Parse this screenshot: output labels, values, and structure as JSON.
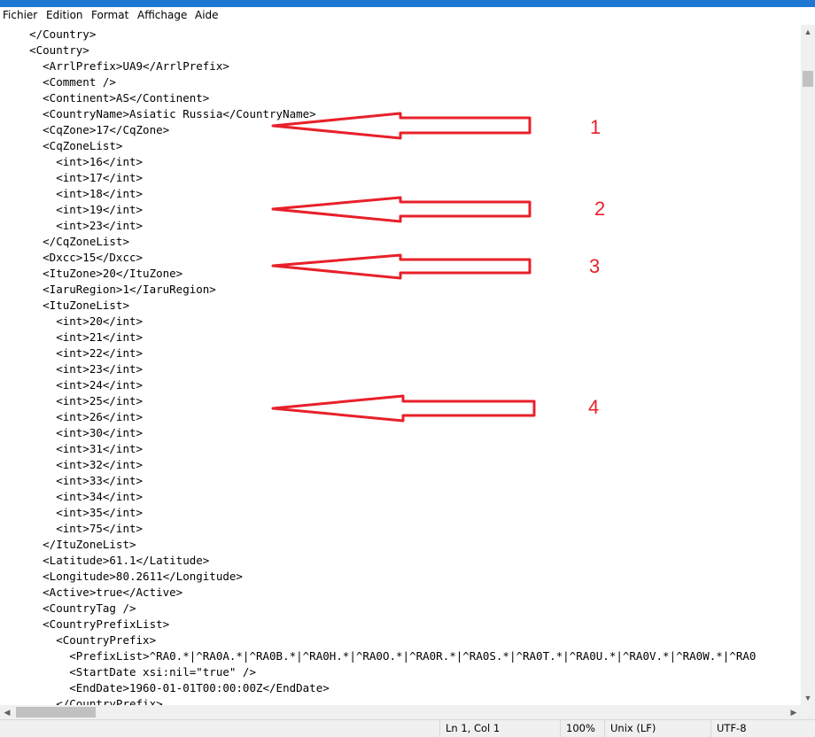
{
  "menu": [
    "Fichier",
    "Edition",
    "Format",
    "Affichage",
    "Aide"
  ],
  "lines": [
    "    </Country>",
    "    <Country>",
    "      <ArrlPrefix>UA9</ArrlPrefix>",
    "      <Comment />",
    "      <Continent>AS</Continent>",
    "      <CountryName>Asiatic Russia</CountryName>",
    "      <CqZone>17</CqZone>",
    "      <CqZoneList>",
    "        <int>16</int>",
    "        <int>17</int>",
    "        <int>18</int>",
    "        <int>19</int>",
    "        <int>23</int>",
    "      </CqZoneList>",
    "      <Dxcc>15</Dxcc>",
    "      <ItuZone>20</ItuZone>",
    "      <IaruRegion>1</IaruRegion>",
    "      <ItuZoneList>",
    "        <int>20</int>",
    "        <int>21</int>",
    "        <int>22</int>",
    "        <int>23</int>",
    "        <int>24</int>",
    "        <int>25</int>",
    "        <int>26</int>",
    "        <int>30</int>",
    "        <int>31</int>",
    "        <int>32</int>",
    "        <int>33</int>",
    "        <int>34</int>",
    "        <int>35</int>",
    "        <int>75</int>",
    "      </ItuZoneList>",
    "      <Latitude>61.1</Latitude>",
    "      <Longitude>80.2611</Longitude>",
    "      <Active>true</Active>",
    "      <CountryTag />",
    "      <CountryPrefixList>",
    "        <CountryPrefix>",
    "          <PrefixList>^RA0.*|^RA0A.*|^RA0B.*|^RA0H.*|^RA0O.*|^RA0R.*|^RA0S.*|^RA0T.*|^RA0U.*|^RA0V.*|^RA0W.*|^RA0",
    "          <StartDate xsi:nil=\"true\" />",
    "          <EndDate>1960-01-01T00:00:00Z</EndDate>",
    "        </CountryPrefix>"
  ],
  "annotations": [
    "1",
    "2",
    "3",
    "4"
  ],
  "annotation_color": "#e8202a",
  "status": {
    "position": "Ln 1, Col 1",
    "zoom": "100%",
    "line_ending": "Unix (LF)",
    "encoding": "UTF-8"
  },
  "icons": {
    "scroll_up": "chevron-up-icon",
    "scroll_down": "chevron-down-icon",
    "scroll_left": "chevron-left-icon",
    "scroll_right": "chevron-right-icon"
  }
}
